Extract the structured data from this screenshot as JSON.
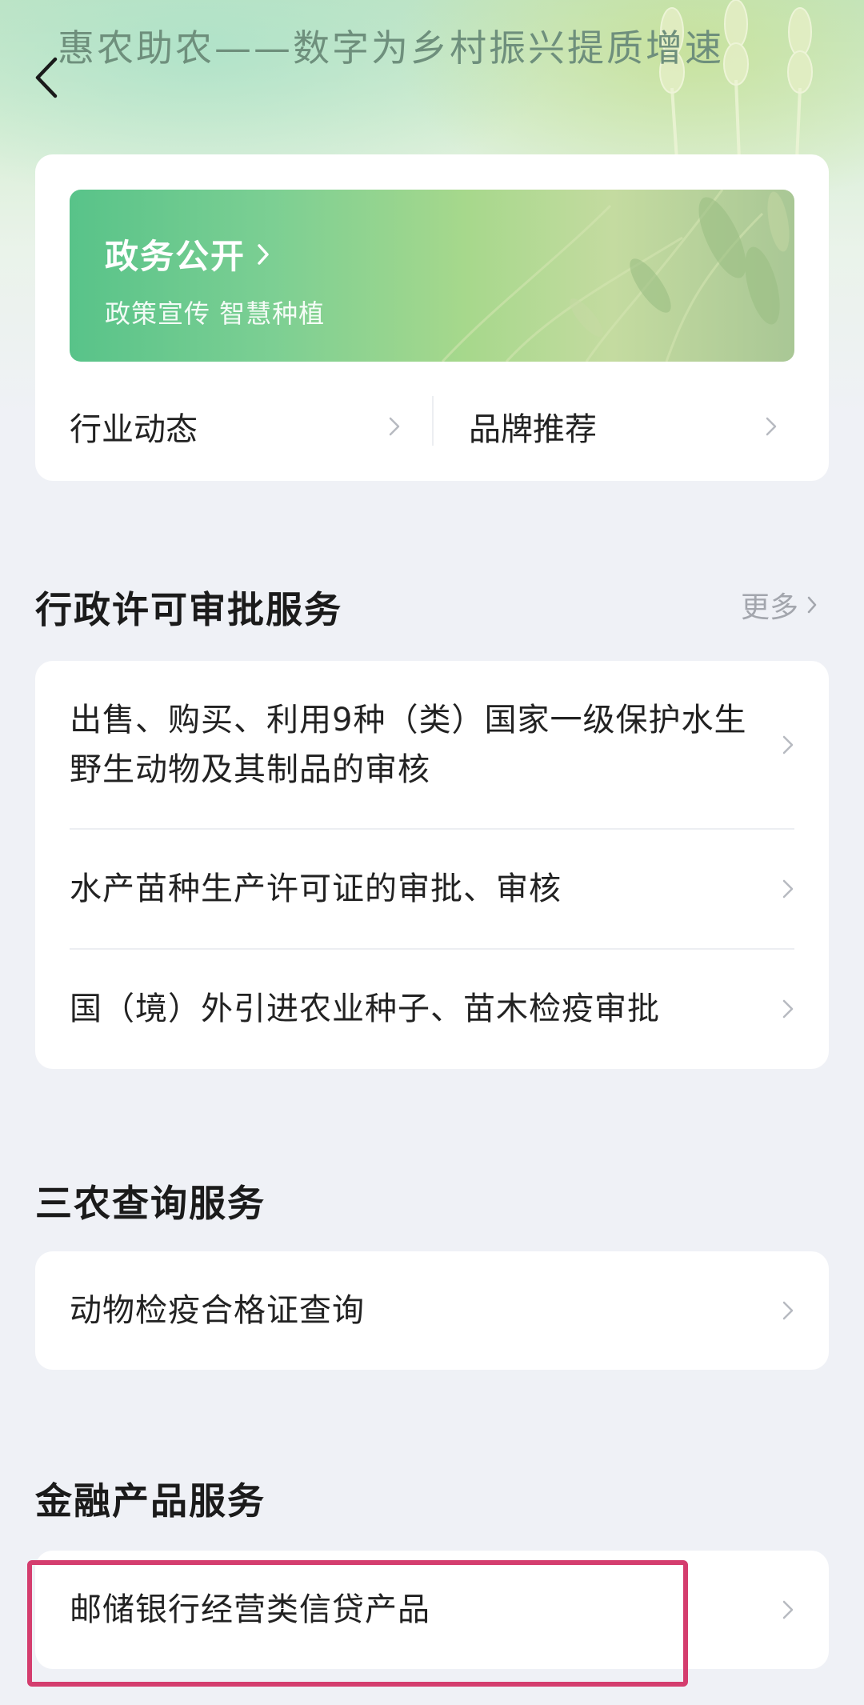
{
  "header": {
    "title": "惠农助农——数字为乡村振兴提质增速",
    "back_icon": "chevron-left-icon"
  },
  "top_card": {
    "banner": {
      "title": "政务公开",
      "subtitle": "政策宣传 智慧种植"
    },
    "links": [
      {
        "label": "行业动态"
      },
      {
        "label": "品牌推荐"
      }
    ]
  },
  "sections": [
    {
      "title": "行政许可审批服务",
      "more_label": "更多",
      "items": [
        {
          "label": "出售、购买、利用9种（类）国家一级保护水生野生动物及其制品的审核"
        },
        {
          "label": "水产苗种生产许可证的审批、审核"
        },
        {
          "label": "国（境）外引进农业种子、苗木检疫审批"
        }
      ]
    },
    {
      "title": "三农查询服务",
      "items": [
        {
          "label": "动物检疫合格证查询"
        }
      ]
    },
    {
      "title": "金融产品服务",
      "items": [
        {
          "label": "邮储银行经营类信贷产品"
        }
      ]
    }
  ],
  "colors": {
    "highlight_border": "#d43d6e",
    "banner_green": "#58c389",
    "page_bg": "#eff1f6"
  }
}
